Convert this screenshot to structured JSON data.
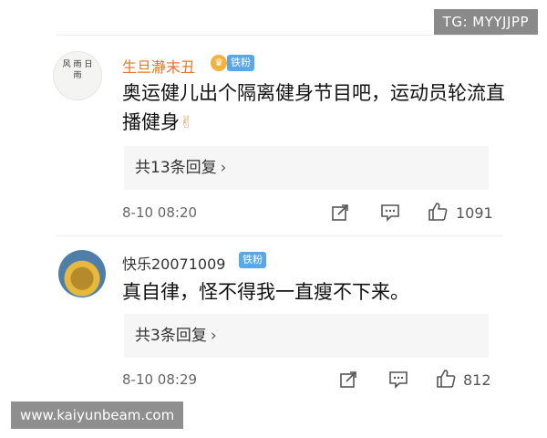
{
  "watermarks": {
    "top": "TG: MYYJJPP",
    "bottom": "www.kaiyunbeam.com"
  },
  "comments": [
    {
      "username": "生旦瀞末丑",
      "badge": "铁粉",
      "text": "奥运健儿出个隔离健身节目吧，运动员轮流直播健身",
      "emoji_icon": "victory-hand-icon",
      "replies": "共13条回复",
      "time": "8-10 08:20",
      "likes": "1091",
      "avatar_text": "风 雨 日 雨"
    },
    {
      "username": "快乐20071009",
      "badge": "铁粉",
      "text": "真自律，怪不得我一直瘦不下来。",
      "replies": "共3条回复",
      "time": "8-10 08:29",
      "likes": "812"
    }
  ],
  "colors": {
    "highlight_username": "#e8742b",
    "badge_bg": "#59a7e8",
    "reply_bg": "#f6f6f6"
  }
}
